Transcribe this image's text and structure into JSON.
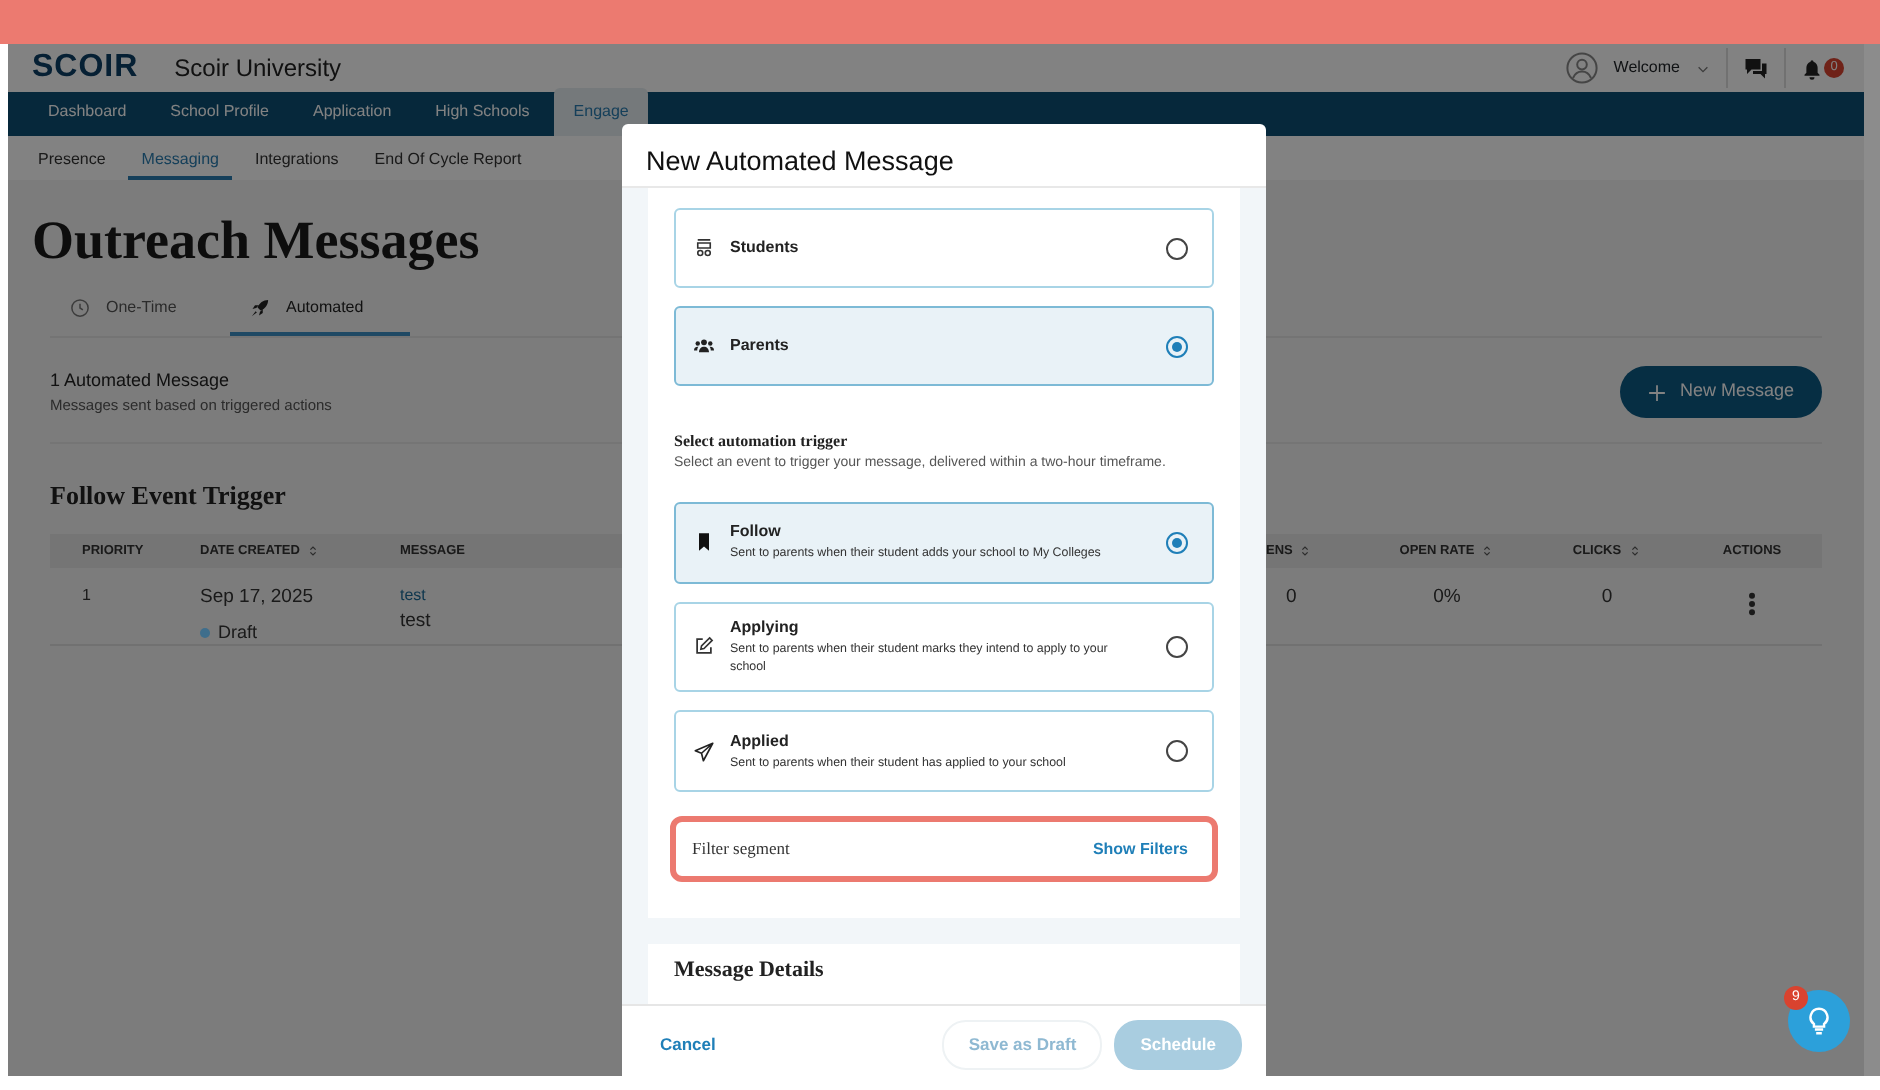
{
  "header": {
    "logo": "SCOIR",
    "school": "Scoir University",
    "user": "Welcome",
    "notifications": "0"
  },
  "nav": [
    {
      "label": "Dashboard",
      "selected": false
    },
    {
      "label": "School Profile",
      "selected": false
    },
    {
      "label": "Application",
      "selected": false
    },
    {
      "label": "High Schools",
      "selected": false
    },
    {
      "label": "Engage",
      "selected": true
    }
  ],
  "subnav": [
    {
      "label": "Presence",
      "selected": false
    },
    {
      "label": "Messaging",
      "selected": true
    },
    {
      "label": "Integrations",
      "selected": false
    },
    {
      "label": "End Of Cycle Report",
      "selected": false
    }
  ],
  "page": {
    "title": "Outreach Messages",
    "tabs": [
      {
        "label": "One-Time",
        "selected": false
      },
      {
        "label": "Automated",
        "selected": true
      }
    ],
    "summary": {
      "title": "1 Automated Message",
      "subtitle": "Messages sent based on triggered actions"
    },
    "new_button": "New Message",
    "section_title": "Follow Event Trigger",
    "table": {
      "columns": [
        {
          "label": "PRIORITY",
          "sortable": false
        },
        {
          "label": "DATE CREATED",
          "sortable": true
        },
        {
          "label": "MESSAGE",
          "sortable": false
        },
        {
          "label": "ENS",
          "sortable": true
        },
        {
          "label": "OPEN RATE",
          "sortable": true
        },
        {
          "label": "CLICKS",
          "sortable": true
        },
        {
          "label": "ACTIONS",
          "sortable": false
        }
      ],
      "rows": [
        {
          "priority": "1",
          "date": "Sep 17, 2025",
          "status": "Draft",
          "color": "#3f6e8c",
          "message_link": "test",
          "message_text": "test",
          "opens": "0",
          "open_rate": "0%",
          "clicks": "0"
        }
      ]
    }
  },
  "modal": {
    "title": "New Automated Message",
    "audience": [
      {
        "label": "Students",
        "selected": false
      },
      {
        "label": "Parents",
        "selected": true
      }
    ],
    "trigger": {
      "title": "Select automation trigger",
      "subtitle": "Select an event to trigger your message, delivered within a two-hour timeframe.",
      "options": [
        {
          "label": "Follow",
          "description": "Sent to parents when their student adds your school to My Colleges",
          "selected": true
        },
        {
          "label": "Applying",
          "description": "Sent to parents when their student marks they intend to apply to your school",
          "selected": false
        },
        {
          "label": "Applied",
          "description": "Sent to parents when their student has applied to your school",
          "selected": false
        }
      ]
    },
    "filter": {
      "label": "Filter segment",
      "action": "Show Filters"
    },
    "details_title": "Message Details",
    "footer": {
      "cancel": "Cancel",
      "save_draft": {
        "label": "Save as Draft",
        "disabled": true
      },
      "schedule": {
        "label": "Schedule",
        "disabled": true
      }
    }
  },
  "help": {
    "badge": "9"
  }
}
